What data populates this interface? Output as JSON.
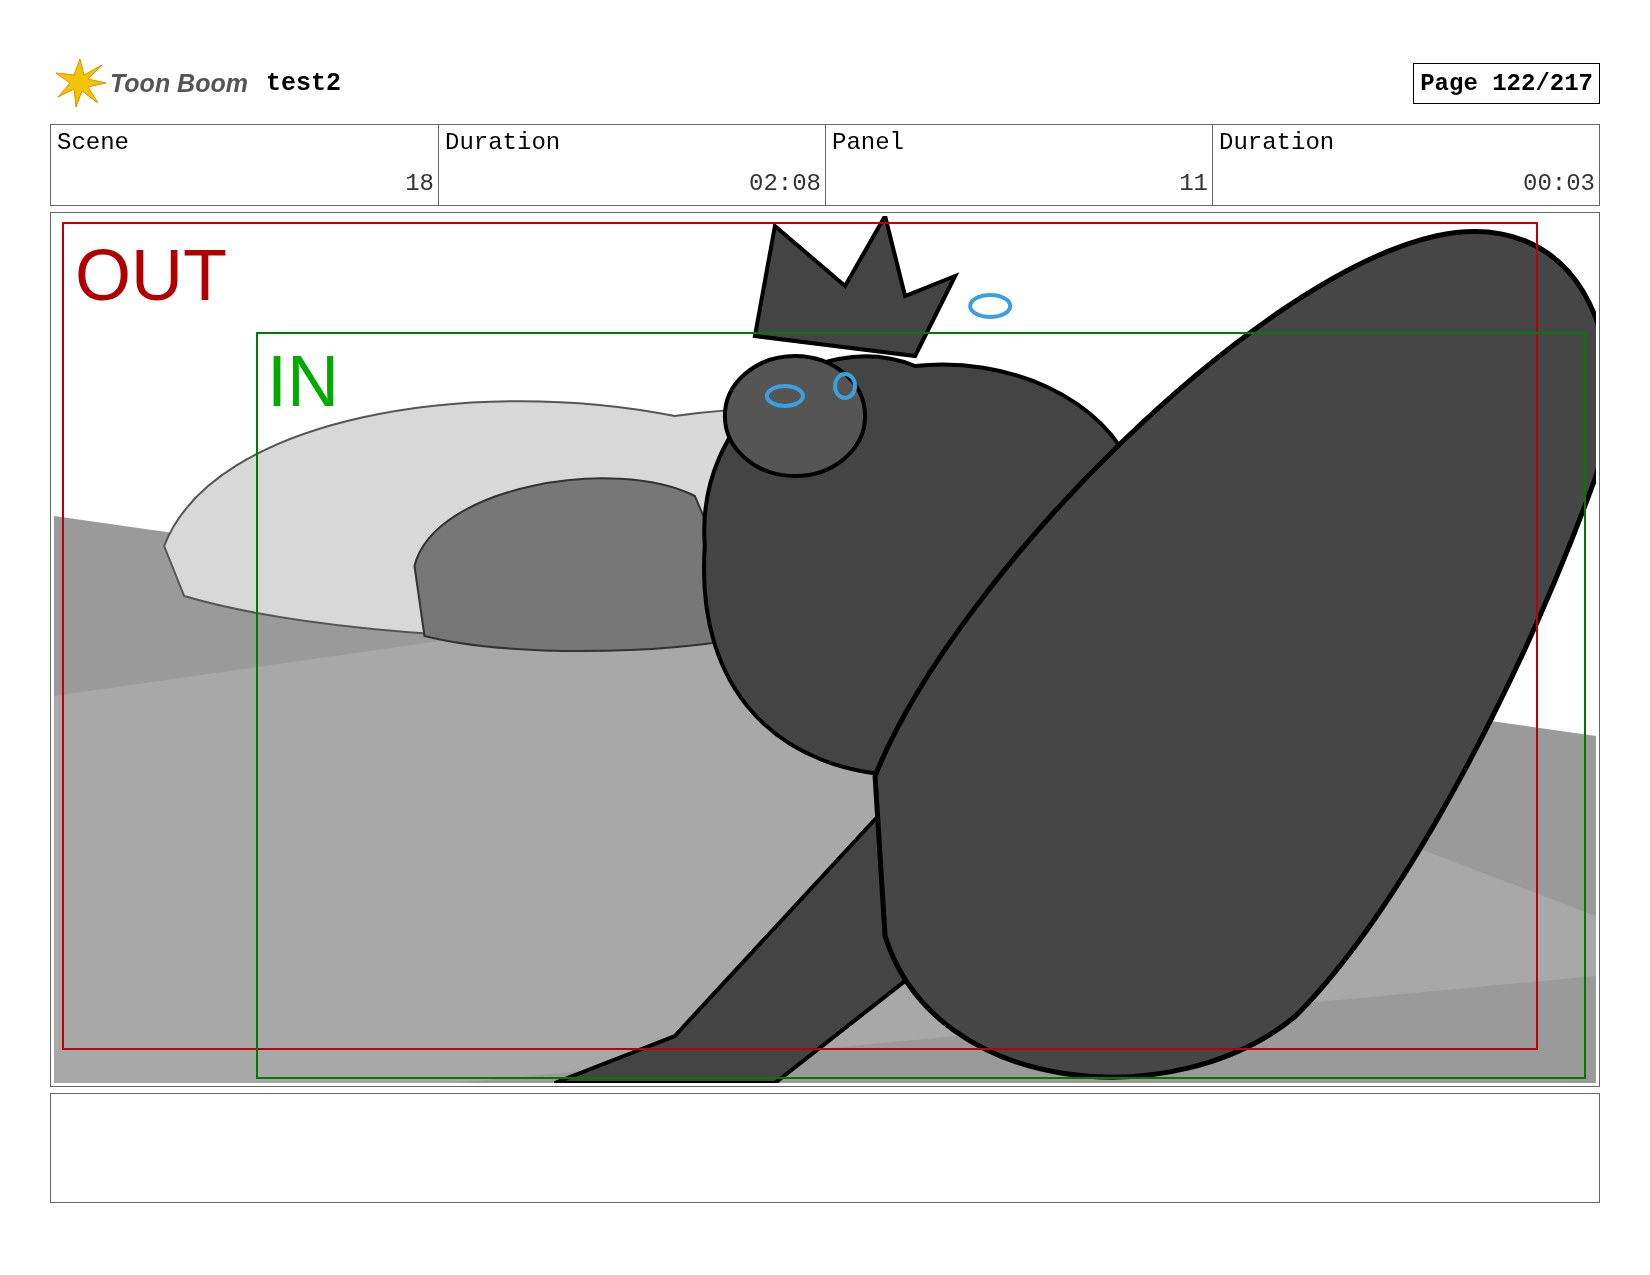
{
  "header": {
    "logo": "Toon Boom",
    "project": "test2",
    "page": "Page 122/217"
  },
  "info": {
    "labels": [
      "Scene",
      "Duration",
      "Panel",
      "Duration"
    ],
    "values": [
      "18",
      "02:08",
      "11",
      "00:03"
    ]
  },
  "panel": {
    "frames": [
      {
        "kind": "out",
        "label": "OUT"
      },
      {
        "kind": "in",
        "label": "IN"
      }
    ]
  }
}
